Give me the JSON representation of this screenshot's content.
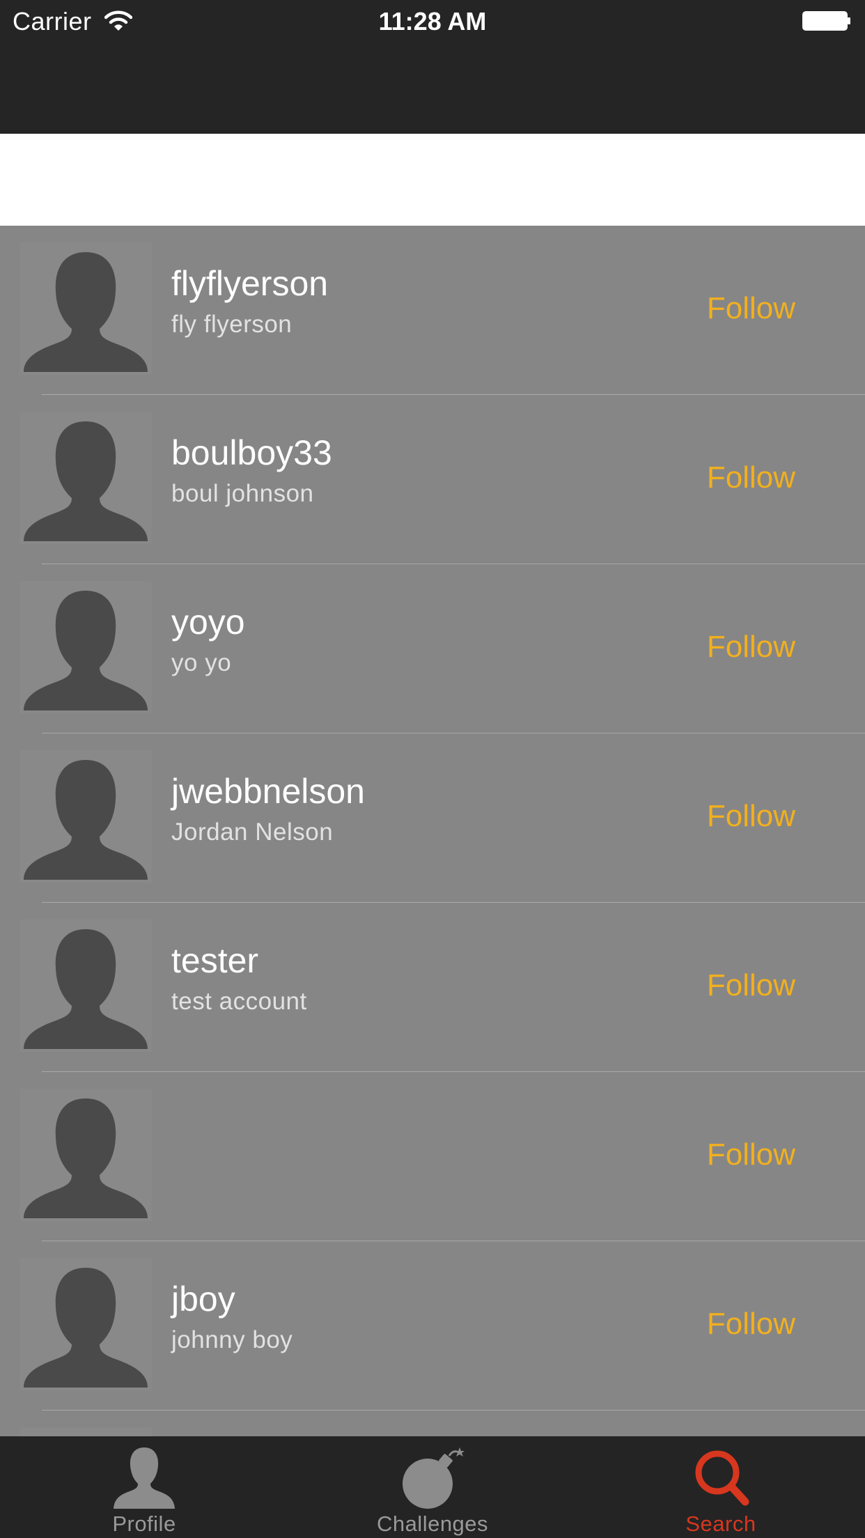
{
  "status_bar": {
    "carrier": "Carrier",
    "time": "11:28 AM"
  },
  "search": {
    "placeholder": ""
  },
  "users": [
    {
      "username": "flyflyerson",
      "full_name": "fly flyerson",
      "follow_label": "Follow"
    },
    {
      "username": "boulboy33",
      "full_name": "boul johnson",
      "follow_label": "Follow"
    },
    {
      "username": "yoyo",
      "full_name": "yo yo",
      "follow_label": "Follow"
    },
    {
      "username": "jwebbnelson",
      "full_name": "Jordan Nelson",
      "follow_label": "Follow"
    },
    {
      "username": "tester",
      "full_name": "test account",
      "follow_label": "Follow"
    },
    {
      "username": "",
      "full_name": "",
      "follow_label": "Follow"
    },
    {
      "username": "jboy",
      "full_name": "johnny boy",
      "follow_label": "Follow"
    },
    {
      "username": "",
      "full_name": "",
      "follow_label": ""
    }
  ],
  "tabs": [
    {
      "label": "Profile",
      "icon": "profile-icon"
    },
    {
      "label": "Challenges",
      "icon": "bomb-icon"
    },
    {
      "label": "Search",
      "icon": "search-icon",
      "active": true
    }
  ],
  "colors": {
    "bar_background": "#252525",
    "list_background": "#868686",
    "follow": "#f2b01e",
    "active_tab": "#d7371f",
    "inactive_tab": "#9a9a9a"
  }
}
